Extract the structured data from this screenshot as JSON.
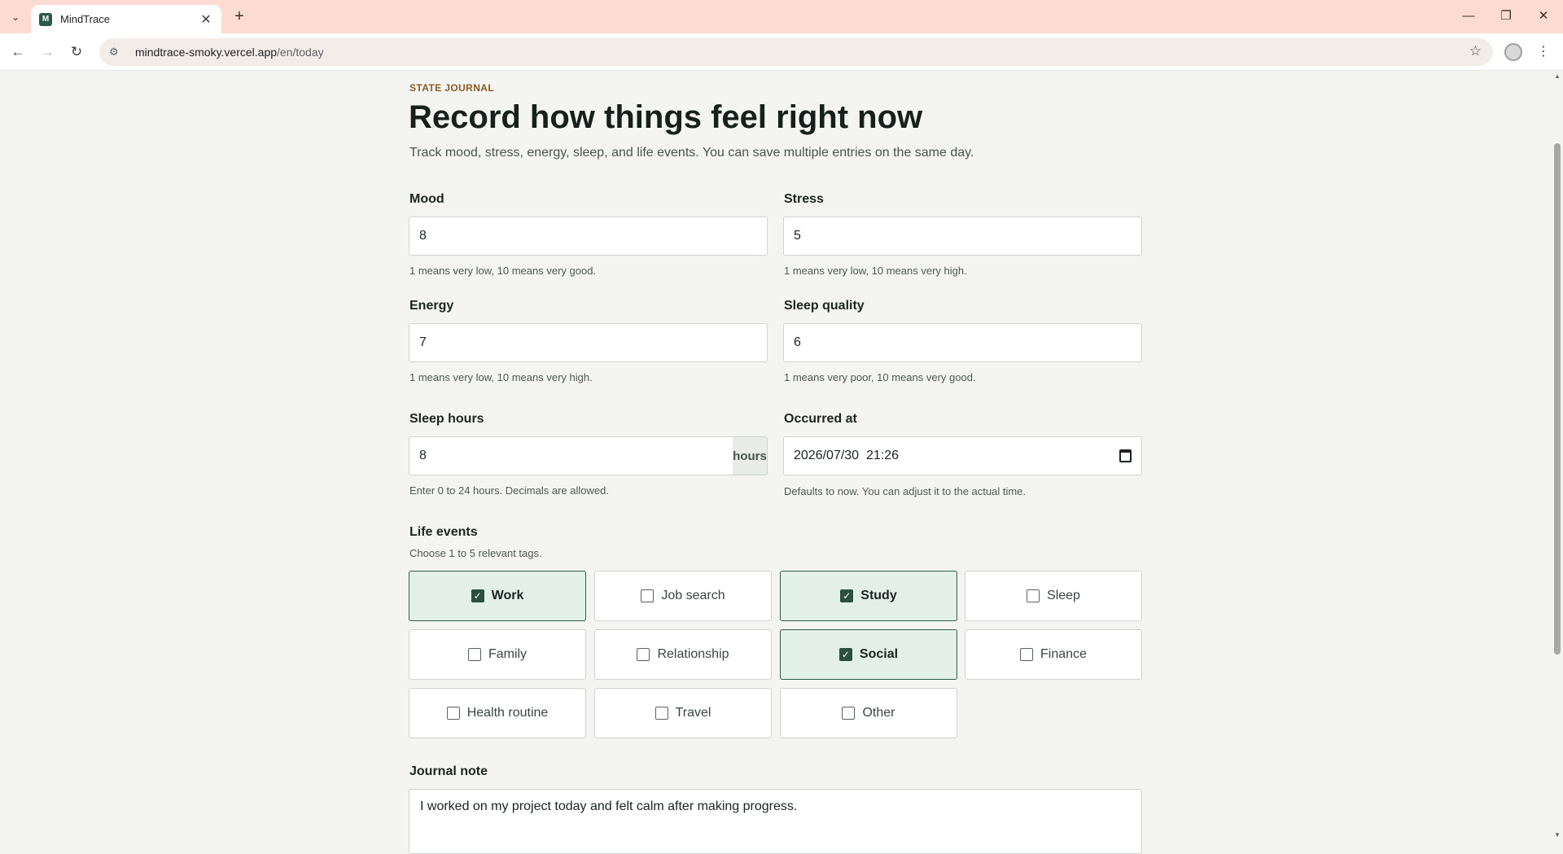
{
  "browser": {
    "tab_title": "MindTrace",
    "favicon_letter": "M",
    "url_host": "mindtrace-smoky.vercel.app",
    "url_path": "/en/today"
  },
  "page": {
    "eyebrow": "STATE JOURNAL",
    "title": "Record how things feel right now",
    "subtitle": "Track mood, stress, energy, sleep, and life events. You can save multiple entries on the same day."
  },
  "fields": {
    "mood": {
      "label": "Mood",
      "value": "8",
      "hint": "1 means very low, 10 means very good."
    },
    "stress": {
      "label": "Stress",
      "value": "5",
      "hint": "1 means very low, 10 means very high."
    },
    "energy": {
      "label": "Energy",
      "value": "7",
      "hint": "1 means very low, 10 means very high."
    },
    "sleep_quality": {
      "label": "Sleep quality",
      "value": "6",
      "hint": "1 means very poor, 10 means very good."
    },
    "sleep_hours": {
      "label": "Sleep hours",
      "value": "8",
      "unit": "hours",
      "hint": "Enter 0 to 24 hours. Decimals are allowed."
    },
    "occurred_at": {
      "label": "Occurred at",
      "value": "2026/07/30  21:26",
      "hint": "Defaults to now. You can adjust it to the actual time."
    }
  },
  "life_events": {
    "label": "Life events",
    "hint": "Choose 1 to 5 relevant tags.",
    "tags": [
      {
        "label": "Work",
        "checked": true
      },
      {
        "label": "Job search",
        "checked": false
      },
      {
        "label": "Study",
        "checked": true
      },
      {
        "label": "Sleep",
        "checked": false
      },
      {
        "label": "Family",
        "checked": false
      },
      {
        "label": "Relationship",
        "checked": false
      },
      {
        "label": "Social",
        "checked": true
      },
      {
        "label": "Finance",
        "checked": false
      },
      {
        "label": "Health routine",
        "checked": false
      },
      {
        "label": "Travel",
        "checked": false
      },
      {
        "label": "Other",
        "checked": false
      }
    ]
  },
  "journal": {
    "label": "Journal note",
    "value": "I worked on my project today and felt calm after making progress."
  }
}
